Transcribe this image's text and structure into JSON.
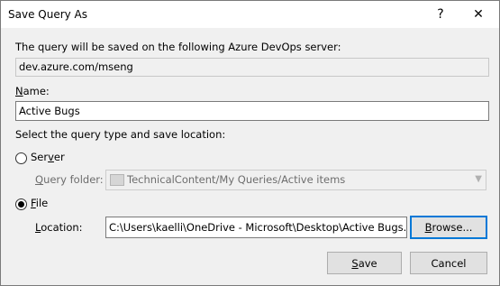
{
  "window": {
    "title": "Save Query As",
    "help_label": "?",
    "close_label": "✕"
  },
  "server": {
    "description": "The query will be saved on the following Azure DevOps server:",
    "value": "dev.azure.com/mseng"
  },
  "name": {
    "label_accel": "N",
    "label_rest": "ame:",
    "value": "Active Bugs"
  },
  "location_section": {
    "heading": "Select the query type and save location:"
  },
  "server_option": {
    "label_pre": "Ser",
    "label_accel": "v",
    "label_post": "er",
    "checked": false
  },
  "query_folder": {
    "label_accel": "Q",
    "label_rest": "uery folder:",
    "value": "TechnicalContent/My Queries/Active items",
    "icon": "folder-icon"
  },
  "file_option": {
    "label_accel": "F",
    "label_rest": "ile",
    "checked": true
  },
  "location": {
    "label_accel": "L",
    "label_rest": "ocation:",
    "value": "C:\\Users\\kaelli\\OneDrive - Microsoft\\Desktop\\Active Bugs.wiq"
  },
  "buttons": {
    "browse_accel": "B",
    "browse_rest": "rowse...",
    "save_accel": "S",
    "save_rest": "ave",
    "cancel": "Cancel"
  }
}
